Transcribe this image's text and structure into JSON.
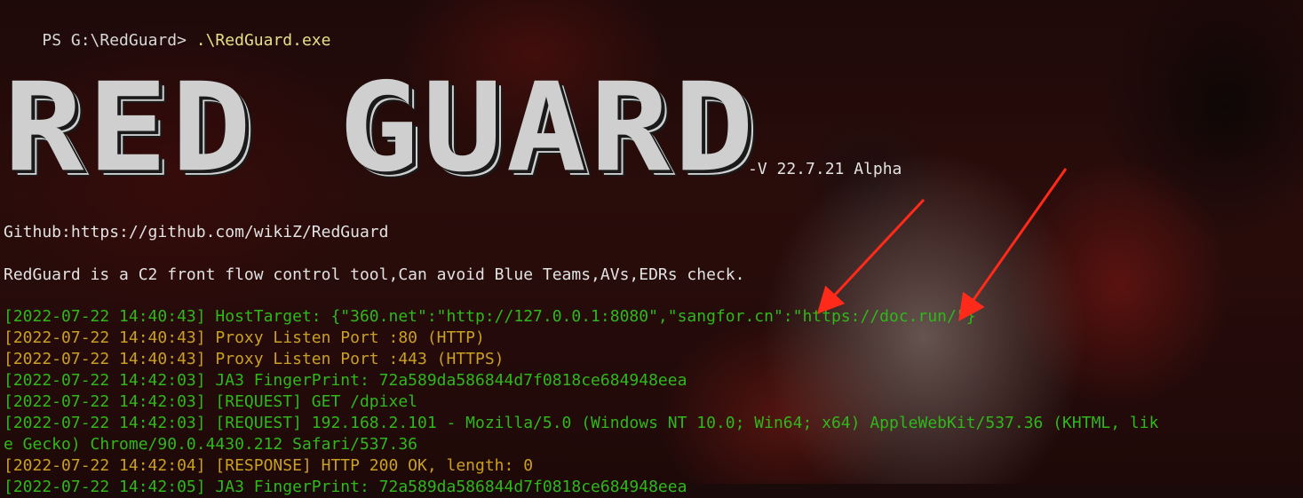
{
  "prompt": "PS G:\\RedGuard>",
  "command": " .\\RedGuard.exe",
  "banner": "RED GUARD",
  "version": "-V 22.7.21 Alpha",
  "github": "Github:https://github.com/wikiZ/RedGuard",
  "description": "RedGuard is a C2 front flow control tool,Can avoid Blue Teams,AVs,EDRs check.",
  "logs": [
    {
      "color": "green",
      "text": "[2022-07-22 14:40:43] HostTarget: {\"360.net\":\"http://127.0.0.1:8080\",\"sangfor.cn\":\"https://doc.run/\"}"
    },
    {
      "color": "gold",
      "text": "[2022-07-22 14:40:43] Proxy Listen Port :80 (HTTP)"
    },
    {
      "color": "gold",
      "text": "[2022-07-22 14:40:43] Proxy Listen Port :443 (HTTPS)"
    },
    {
      "color": "green",
      "text": "[2022-07-22 14:42:03] JA3 FingerPrint: 72a589da586844d7f0818ce684948eea"
    },
    {
      "color": "green",
      "text": "[2022-07-22 14:42:03] [REQUEST] GET /dpixel"
    },
    {
      "color": "green",
      "text": "[2022-07-22 14:42:03] [REQUEST] 192.168.2.101 - Mozilla/5.0 (Windows NT 10.0; Win64; x64) AppleWebKit/537.36 (KHTML, lik"
    },
    {
      "color": "green",
      "text": "e Gecko) Chrome/90.0.4430.212 Safari/537.36"
    },
    {
      "color": "gold",
      "text": "[2022-07-22 14:42:04] [RESPONSE] HTTP 200 OK, length: 0"
    },
    {
      "color": "green",
      "text": "[2022-07-22 14:42:05] JA3 FingerPrint: 72a589da586844d7f0818ce684948eea"
    }
  ],
  "colors": {
    "green": "#2fb81a",
    "gold": "#c9a022",
    "arrow": "#ff2a1a"
  }
}
